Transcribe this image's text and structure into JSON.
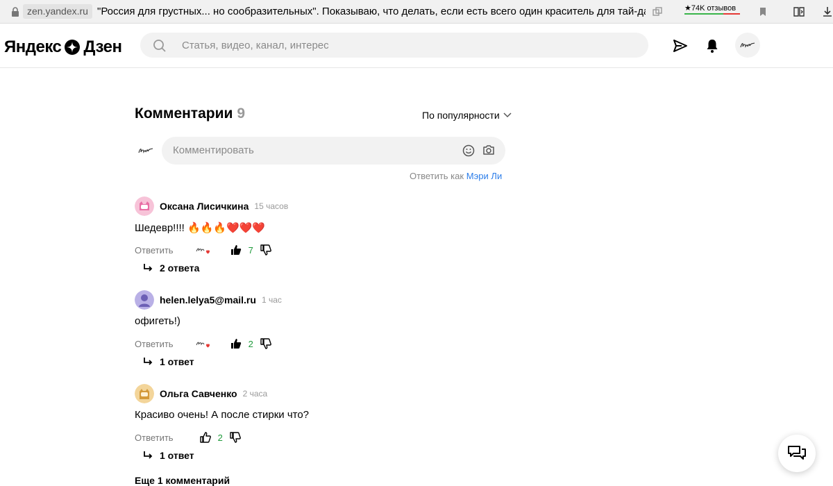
{
  "browser": {
    "domain": "zen.yandex.ru",
    "page_title": "\"Россия для грустных... но сообразительных\". Показываю, что делать, если есть всего один краситель для тай-дай...",
    "reviews": "★74K отзывов"
  },
  "header": {
    "logo_left": "Яндекс",
    "logo_right": "Дзен",
    "search_placeholder": "Статья, видео, канал, интерес"
  },
  "comments": {
    "title": "Комментарии",
    "count": "9",
    "sort_label": "По популярности",
    "input_placeholder": "Комментировать",
    "reply_as_label": "Ответить как",
    "reply_as_name": "Мэри Ли",
    "items": [
      {
        "author": "Оксана Лисичкина",
        "time": "15 часов",
        "text": "Шедевр!!!! 🔥🔥🔥❤️❤️❤️",
        "reply_label": "Ответить",
        "likes": "7",
        "replies": "2 ответа",
        "author_liked": true,
        "avatar_color": "#f4a9c9"
      },
      {
        "author": "helen.lelya5@mail.ru",
        "time": "1 час",
        "text": "офигеть!)",
        "reply_label": "Ответить",
        "likes": "2",
        "replies": "1 ответ",
        "author_liked": true,
        "avatar_color": "#9b8fd1"
      },
      {
        "author": "Ольга Савченко",
        "time": "2 часа",
        "text": "Красиво очень! А после стирки что?",
        "reply_label": "Ответить",
        "likes": "2",
        "replies": "1 ответ",
        "author_liked": false,
        "avatar_color": "#e8b860"
      }
    ],
    "more_label": "Еще 1 комментарий"
  }
}
